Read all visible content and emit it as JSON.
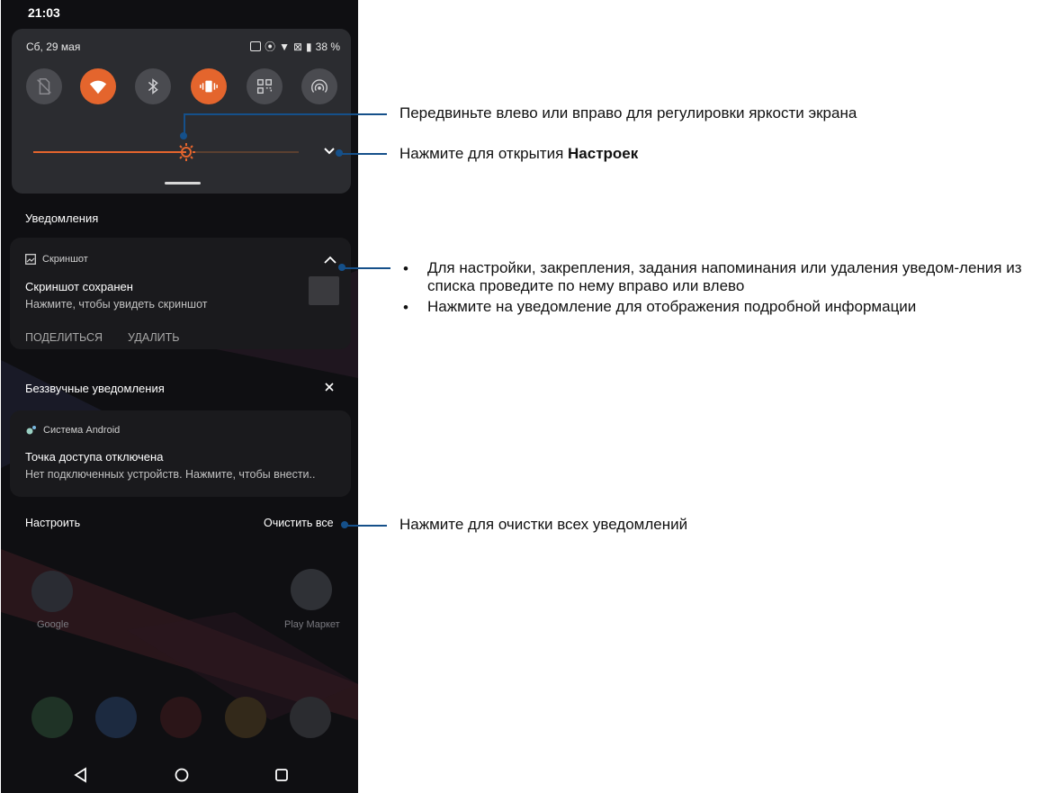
{
  "status_bar": {
    "time": "21:03"
  },
  "quick_settings": {
    "date": "Сб, 29 мая",
    "battery": "38 %",
    "tiles": [
      {
        "icon": "no-sim-icon",
        "active": false
      },
      {
        "icon": "wifi-icon",
        "active": true
      },
      {
        "icon": "bluetooth-icon",
        "active": false
      },
      {
        "icon": "vibrate-icon",
        "active": true
      },
      {
        "icon": "qr-scanner-icon",
        "active": false
      },
      {
        "icon": "hotspot-icon",
        "active": false
      }
    ],
    "brightness_level": 0.45
  },
  "notifications": {
    "section_title": "Уведомления",
    "screenshot": {
      "app_name": "Скриншот",
      "title": "Скриншот сохранен",
      "text": "Нажмите, чтобы увидеть скриншот",
      "actions": [
        "ПОДЕЛИТЬСЯ",
        "УДАЛИТЬ"
      ]
    },
    "silent_title": "Беззвучные уведомления",
    "android": {
      "app_name": "Система Android",
      "title": "Точка доступа отключена",
      "text": "Нет подключенных устройств. Нажмите, чтобы внести.."
    },
    "manage_label": "Настроить",
    "clear_all_label": "Очистить все"
  },
  "home": {
    "apps": [
      {
        "label": "Google"
      },
      {
        "label": "Play Маркет"
      }
    ]
  },
  "callouts": {
    "brightness": "Передвиньте влево или вправо для регулировки яркости экрана",
    "settings_prefix": "Нажмите для открытия ",
    "settings_bold": "Настроек",
    "bullet_1": "Для настройки, закрепления, задания напоминания или удаления уведом-ления из списка проведите по нему вправо или влево",
    "bullet_2": "Нажмите на уведомление для отображения подробной информации",
    "clear_all": "Нажмите для очистки всех уведомлений"
  },
  "colors": {
    "accent": "#e4652d",
    "callout": "#15508a",
    "panel": "#2b2c30"
  }
}
